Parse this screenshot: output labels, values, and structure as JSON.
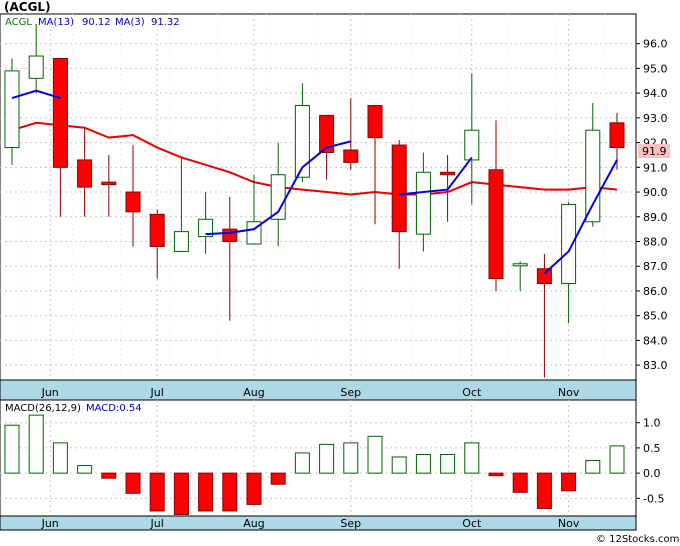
{
  "chart_title": "(ACGL)",
  "watermark": "© 12Stocks.com",
  "price_legend": {
    "ticker": "ACGL",
    "ma13_label": "MA(13)",
    "ma13_value": "90.12",
    "ma3_label": "MA(3)",
    "ma3_value": "91.32"
  },
  "macd_legend": {
    "label": "MACD(26,12,9)",
    "value_label": "MACD:0.54"
  },
  "last_price_label": "91.9",
  "colors": {
    "up_candle": "#ffffff",
    "up_outline": "#006400",
    "down_candle": "#ff0000",
    "down_outline": "#8b0000",
    "ma13": "#e60000",
    "ma3": "#0000dd",
    "axis_band": "#add8e6",
    "grid": "#c8c8c8",
    "last_price_bg": "#ffc0c0",
    "ticker_text": "#008000",
    "ma_legend_text": "#0000cc"
  },
  "chart_data": [
    {
      "type": "candlestick",
      "x_labels": [
        "Jun",
        "Jul",
        "Aug",
        "Sep",
        "Oct",
        "Nov"
      ],
      "x_label_positions": [
        1,
        6,
        10,
        14,
        19,
        23
      ],
      "ylim": [
        82.4,
        97.2
      ],
      "y_ticks": [
        "83.0",
        "84.0",
        "85.0",
        "86.0",
        "87.0",
        "88.0",
        "89.0",
        "90.0",
        "91.0",
        "92.0",
        "93.0",
        "94.0",
        "95.0",
        "96.0"
      ],
      "candles": [
        {
          "o": 91.8,
          "h": 95.4,
          "l": 91.1,
          "c": 94.9
        },
        {
          "o": 94.6,
          "h": 96.8,
          "l": 94.0,
          "c": 95.5
        },
        {
          "o": 95.4,
          "h": 95.4,
          "l": 89.0,
          "c": 91.0
        },
        {
          "o": 91.3,
          "h": 92.6,
          "l": 89.0,
          "c": 90.2
        },
        {
          "o": 90.4,
          "h": 91.5,
          "l": 89.0,
          "c": 90.3
        },
        {
          "o": 90.0,
          "h": 91.9,
          "l": 87.8,
          "c": 89.2
        },
        {
          "o": 89.1,
          "h": 89.3,
          "l": 86.5,
          "c": 87.8
        },
        {
          "o": 87.6,
          "h": 91.4,
          "l": 87.6,
          "c": 88.4
        },
        {
          "o": 88.2,
          "h": 90.0,
          "l": 87.5,
          "c": 88.9
        },
        {
          "o": 88.5,
          "h": 89.8,
          "l": 84.8,
          "c": 88.0
        },
        {
          "o": 87.9,
          "h": 90.7,
          "l": 87.9,
          "c": 88.8
        },
        {
          "o": 88.9,
          "h": 92.0,
          "l": 87.8,
          "c": 90.7
        },
        {
          "o": 90.6,
          "h": 94.4,
          "l": 90.4,
          "c": 93.5
        },
        {
          "o": 93.1,
          "h": 93.1,
          "l": 90.5,
          "c": 91.6
        },
        {
          "o": 91.7,
          "h": 93.8,
          "l": 90.9,
          "c": 91.2
        },
        {
          "o": 93.5,
          "h": 93.5,
          "l": 88.7,
          "c": 92.2
        },
        {
          "o": 91.9,
          "h": 92.1,
          "l": 86.9,
          "c": 88.4
        },
        {
          "o": 88.3,
          "h": 91.6,
          "l": 87.6,
          "c": 90.8
        },
        {
          "o": 90.8,
          "h": 91.5,
          "l": 88.8,
          "c": 90.7
        },
        {
          "o": 91.3,
          "h": 94.8,
          "l": 89.5,
          "c": 92.5
        },
        {
          "o": 90.9,
          "h": 92.9,
          "l": 86.0,
          "c": 86.5
        },
        {
          "o": 87.1,
          "h": 87.2,
          "l": 86.0,
          "c": 87.1
        },
        {
          "o": 86.9,
          "h": 87.5,
          "l": 82.5,
          "c": 86.3
        },
        {
          "o": 86.3,
          "h": 89.6,
          "l": 84.7,
          "c": 89.5
        },
        {
          "o": 88.8,
          "h": 93.6,
          "l": 88.6,
          "c": 92.5
        },
        {
          "o": 92.8,
          "h": 93.2,
          "l": 90.9,
          "c": 91.8
        }
      ],
      "ma13": [
        92.5,
        92.8,
        92.7,
        92.6,
        92.2,
        92.3,
        91.8,
        91.4,
        91.1,
        90.8,
        90.4,
        90.2,
        90.1,
        90.0,
        89.9,
        90.0,
        89.9,
        89.9,
        90.0,
        90.4,
        90.3,
        90.2,
        90.1,
        90.1,
        90.2,
        90.1
      ],
      "ma3": [
        93.8,
        94.1,
        93.8,
        null,
        null,
        null,
        null,
        null,
        88.3,
        88.35,
        88.5,
        89.2,
        91.0,
        91.8,
        92.05,
        null,
        89.9,
        90.0,
        90.1,
        91.4,
        null,
        null,
        86.7,
        87.6,
        89.5,
        91.3
      ]
    },
    {
      "type": "bar",
      "title": "MACD(26,12,9)",
      "x_labels": [
        "Jun",
        "Jul",
        "Aug",
        "Sep",
        "Oct",
        "Nov"
      ],
      "ylim": [
        -0.85,
        1.45
      ],
      "y_ticks": [
        "1.0",
        "0.5",
        "0.0",
        "-0.5"
      ],
      "values": [
        0.95,
        1.15,
        0.6,
        0.15,
        -0.1,
        -0.4,
        -0.75,
        -0.82,
        -0.75,
        -0.75,
        -0.62,
        -0.22,
        0.4,
        0.57,
        0.6,
        0.73,
        0.32,
        0.37,
        0.37,
        0.6,
        -0.05,
        -0.38,
        -0.7,
        -0.35,
        0.25,
        0.54
      ]
    }
  ]
}
